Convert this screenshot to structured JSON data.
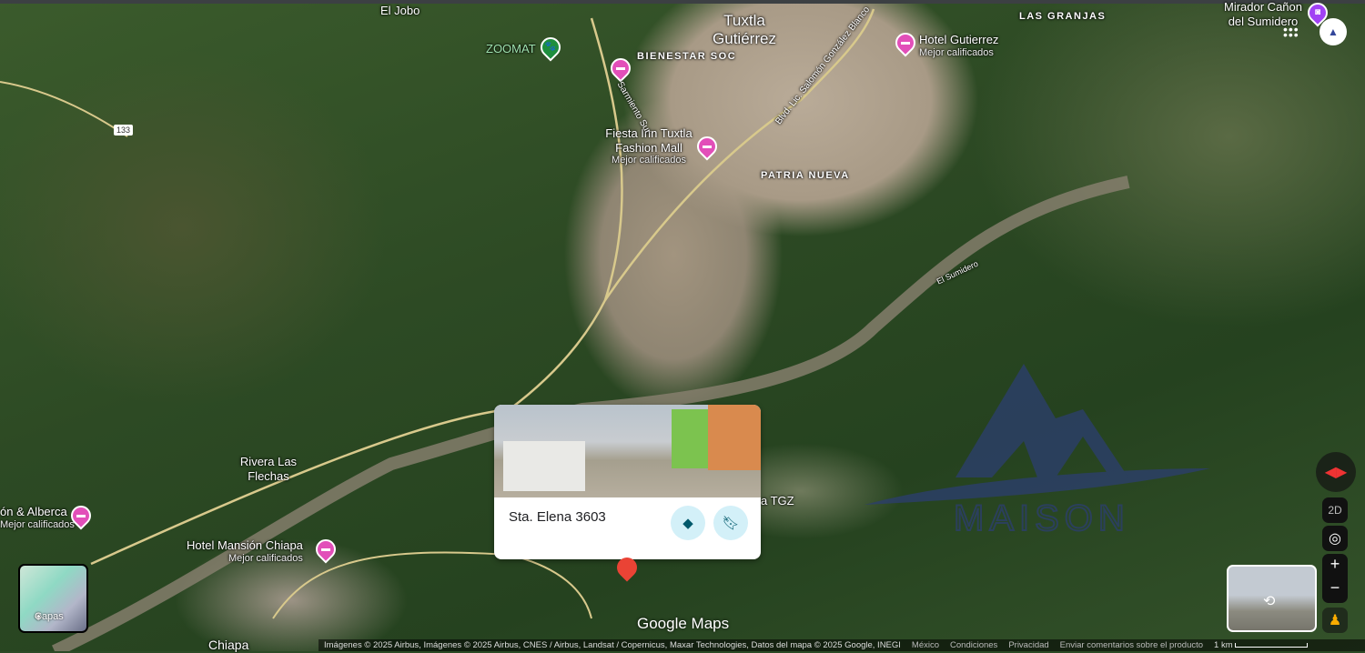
{
  "map": {
    "labels": {
      "el_jobo": "El Jobo",
      "zoomat": "ZOOMAT",
      "tuxtla": "Tuxtla Gutiérrez",
      "bienestar": "BIENESTAR SOC",
      "las_granjas": "LAS GRANJAS",
      "hotel_gutierrez": "Hotel Gutierrez",
      "mirador": "Mirador Cañon del Sumidero",
      "fiesta_inn": "Fiesta Inn Tuxtla Fashion Mall",
      "patria_nueva": "PATRIA NUEVA",
      "el_sumidero": "El Sumidero",
      "rivera": "Rivera Las Flechas",
      "alberca": "ón & Alberca",
      "mansion": "Hotel Mansión Chiapa",
      "chiapa": "Chiapa",
      "tgz": "a TGZ",
      "sarmiento": "Sarmiento Sur",
      "blvd": "Blvd. Lic. Salomón González Blanco",
      "mejor": "Mejor calificados",
      "route": "133"
    },
    "watermark": "MAISON"
  },
  "card": {
    "title": "Sta. Elena 3603",
    "directions_icon": "directions-icon",
    "save_icon": "bookmark-icon"
  },
  "controls": {
    "mode": "2D",
    "zoom_in": "+",
    "zoom_out": "−",
    "layers_label": "Capas"
  },
  "logo": "Google Maps",
  "attribution": {
    "imagery": "Imágenes © 2025 Airbus, Imágenes © 2025 Airbus, CNES / Airbus, Landsat / Copernicus, Maxar Technologies, Datos del mapa © 2025 Google, INEGI",
    "country": "México",
    "terms": "Condiciones",
    "privacy": "Privacidad",
    "feedback": "Enviar comentarios sobre el producto",
    "scale": "1 km"
  },
  "colors": {
    "hotel_pin": "#e24fb9",
    "zoo_pin": "#1e8e3e",
    "attraction_pin": "#a142f4",
    "place_pin": "#ea4335",
    "card_button": "#d3f0f8"
  }
}
